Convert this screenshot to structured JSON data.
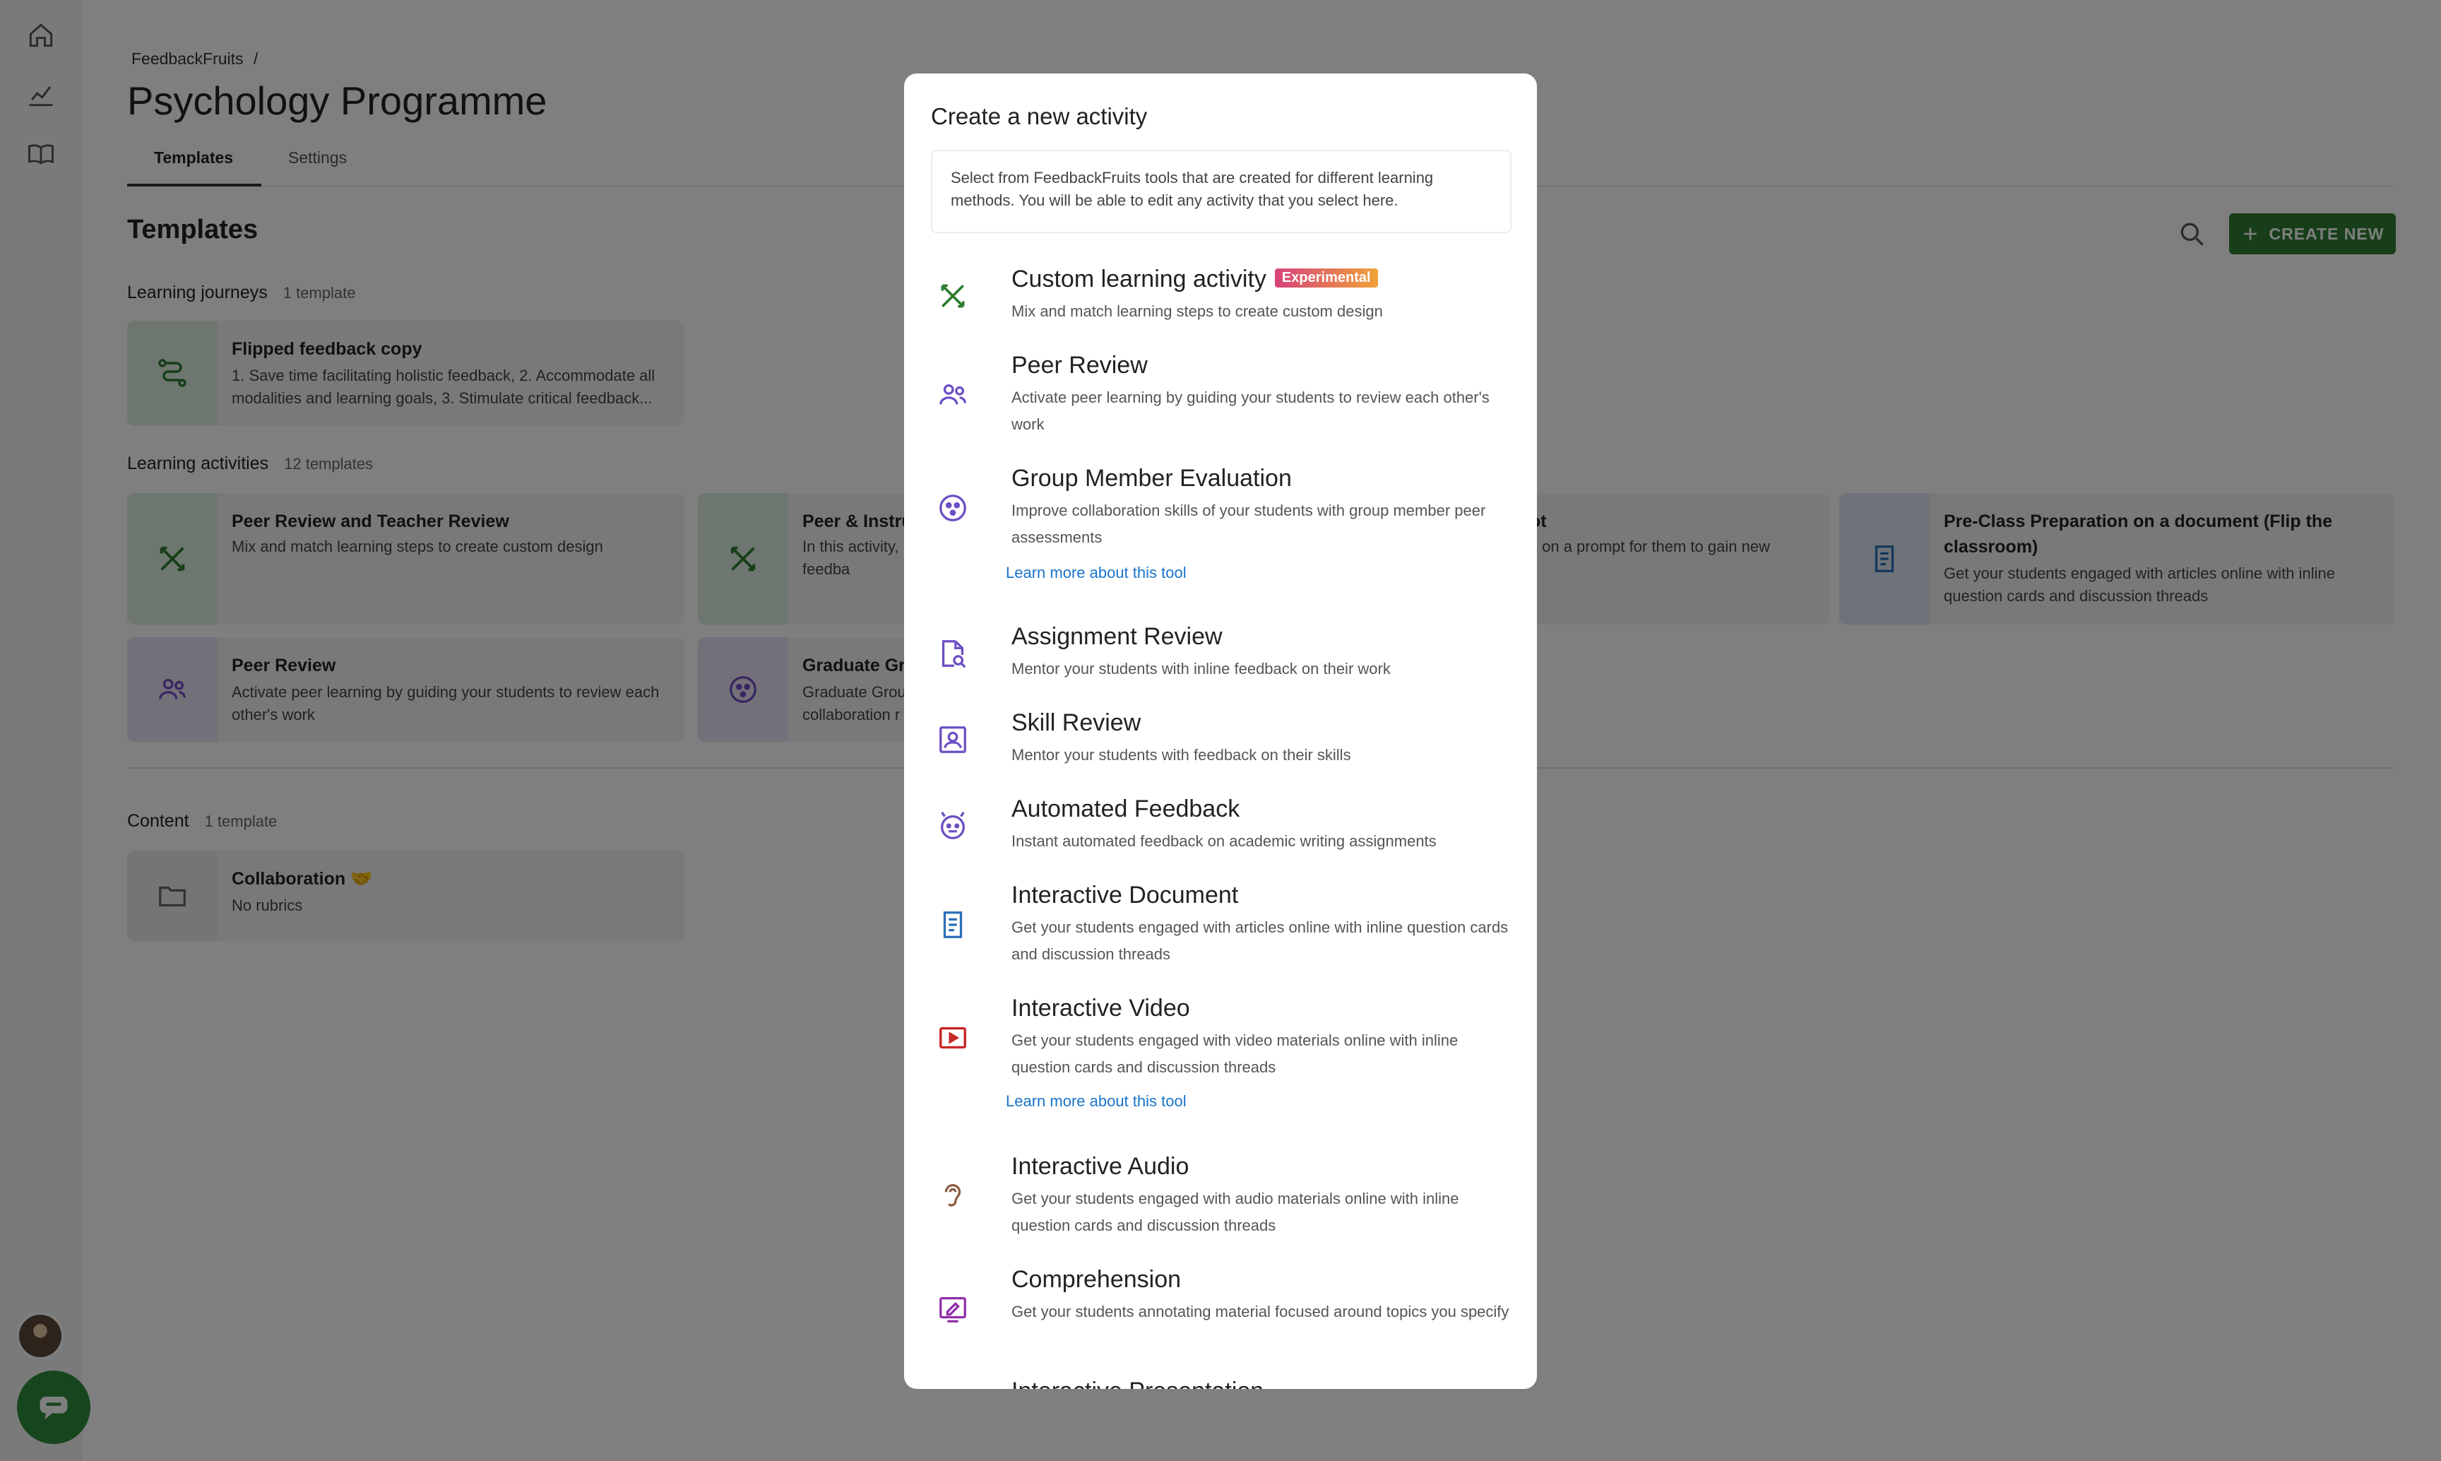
{
  "breadcrumb": {
    "root": "FeedbackFruits",
    "separator": "/"
  },
  "page": {
    "title": "Psychology Programme"
  },
  "tabs": [
    {
      "label": "Templates"
    },
    {
      "label": "Settings"
    }
  ],
  "templates": {
    "title": "Templates",
    "create_label": "CREATE NEW",
    "learning_journeys": {
      "label": "Learning journeys",
      "count": "1 template",
      "cards": [
        {
          "title": "Flipped feedback copy",
          "desc": "1. Save time facilitating holistic feedback, 2. Accommodate all modalities and learning goals, 3. Stimulate critical feedback..."
        }
      ]
    },
    "learning_activities": {
      "label": "Learning activities",
      "count": "12 templates",
      "cards": [
        {
          "title": "Peer Review and Teacher Review",
          "desc": "Mix and match learning steps to create custom design"
        },
        {
          "title": "Peer & Instru",
          "desc": "In this activity, receive feedba"
        },
        {
          "title": "ot",
          "desc": "s on a prompt for them to gain new"
        },
        {
          "title": "Pre-Class Preparation on a document (Flip the classroom)",
          "desc": "Get your students engaged with articles online with inline question cards and discussion threads"
        },
        {
          "title": "Peer Review",
          "desc": "Activate peer learning by guiding your students to review each other's work"
        },
        {
          "title": "Graduate Gr",
          "desc": "Graduate Grou collaboration r"
        }
      ]
    },
    "content": {
      "label": "Content",
      "count": "1 template",
      "cards": [
        {
          "title": "Collaboration 🤝",
          "desc": "No rubrics"
        }
      ]
    }
  },
  "modal": {
    "title": "Create a new activity",
    "intro": "Select from FeedbackFruits tools that are created for different learning methods. You will be able to edit any activity that you select here.",
    "learn_more": "Learn more about this tool",
    "tools": [
      {
        "name": "Custom learning activity",
        "badge": "Experimental",
        "desc": "Mix and match learning steps to create custom design",
        "icon": "custom-activity-icon",
        "color": "#2e7d32"
      },
      {
        "name": "Peer Review",
        "desc": "Activate peer learning by guiding your students to review each other's work",
        "icon": "peer-review-icon",
        "color": "#6b4fc4"
      },
      {
        "name": "Group Member Evaluation",
        "desc": "Improve collaboration skills of your students with group member peer assessments",
        "icon": "group-evaluation-icon",
        "color": "#6b4fc4"
      },
      {
        "name": "Assignment Review",
        "desc": "Mentor your students with inline feedback on their work",
        "icon": "assignment-review-icon",
        "color": "#6b4fc4"
      },
      {
        "name": "Skill Review",
        "desc": "Mentor your students with feedback on their skills",
        "icon": "skill-review-icon",
        "color": "#6b4fc4"
      },
      {
        "name": "Automated Feedback",
        "desc": "Instant automated feedback on academic writing assignments",
        "icon": "automated-feedback-icon",
        "color": "#6b4fc4"
      },
      {
        "name": "Interactive Document",
        "desc": "Get your students engaged with articles online with inline question cards and discussion threads",
        "icon": "document-icon",
        "color": "#2a6fb8"
      },
      {
        "name": "Interactive Video",
        "desc": "Get your students engaged with video materials online with inline question cards and discussion threads",
        "icon": "video-icon",
        "color": "#c62828"
      },
      {
        "name": "Interactive Audio",
        "desc": "Get your students engaged with audio materials online with inline question cards and discussion threads",
        "icon": "ear-icon",
        "color": "#8d5a3c"
      },
      {
        "name": "Comprehension",
        "desc": "Get your students annotating material focused around topics you specify",
        "icon": "comprehension-icon",
        "color": "#8e2fa8"
      },
      {
        "name": "Interactive Presentation",
        "icon": "presentation-icon",
        "color": "#8e2fa8"
      }
    ]
  }
}
